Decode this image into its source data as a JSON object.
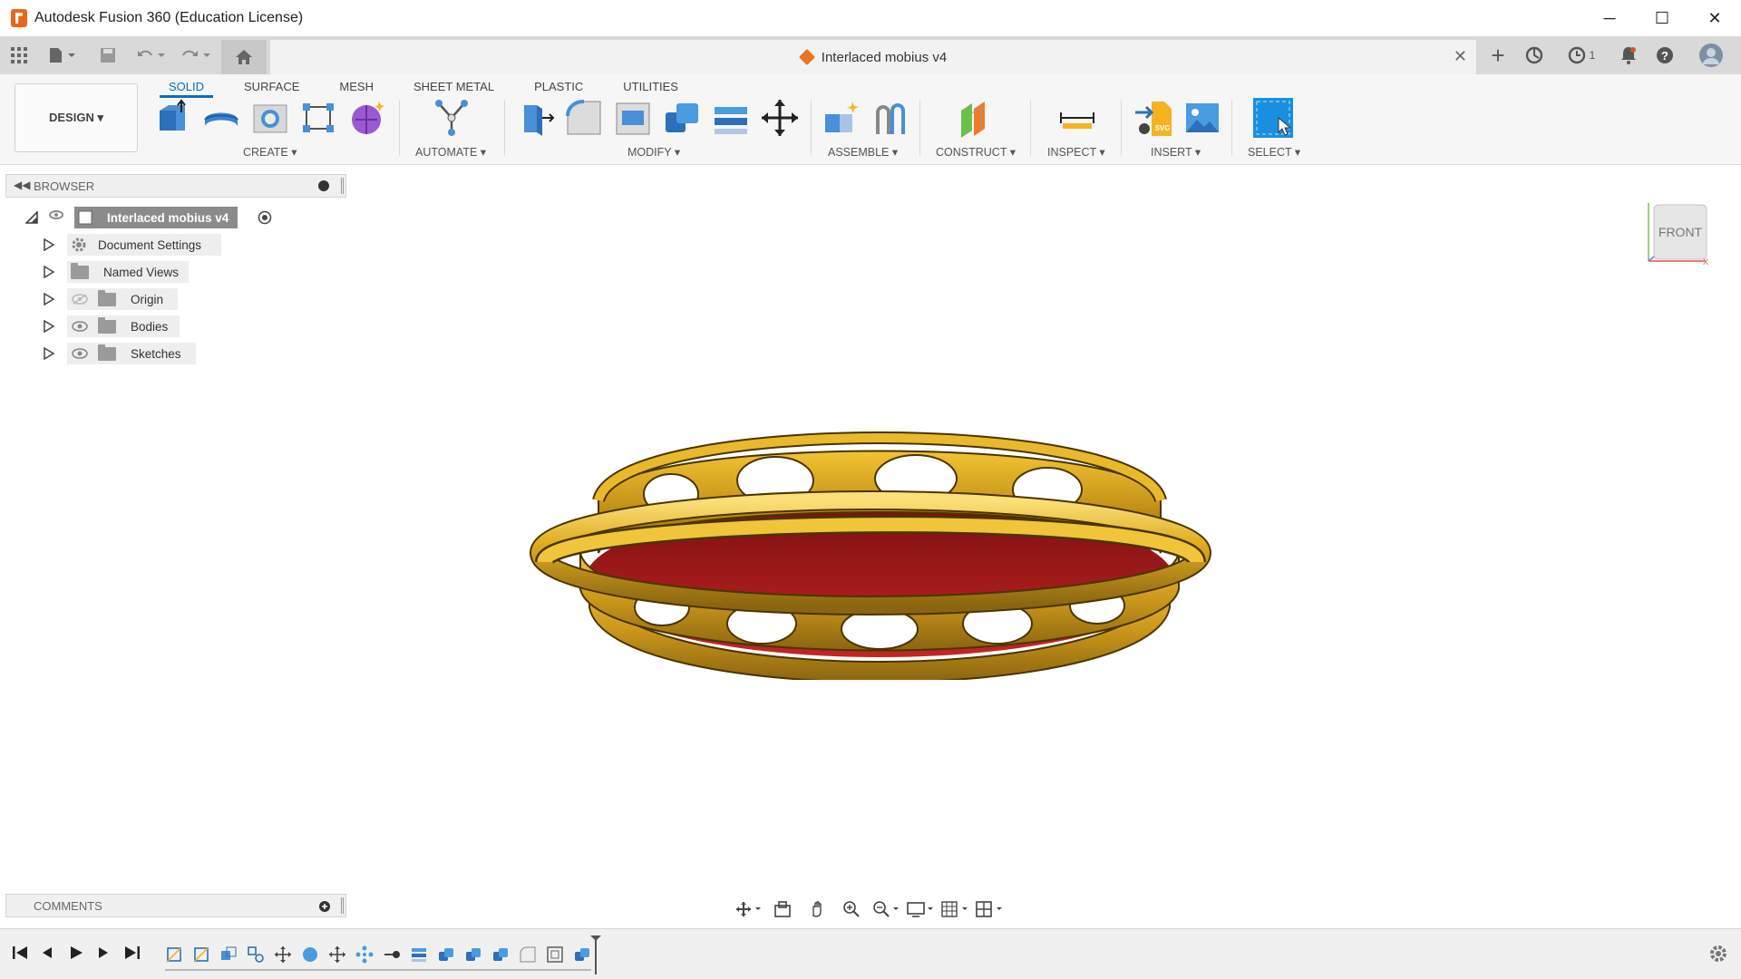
{
  "window": {
    "title": "Autodesk Fusion 360 (Education License)",
    "minimize": "─",
    "maximize": "☐",
    "close": "✕"
  },
  "tabs": {
    "document_title": "Interlaced mobius v4",
    "close": "✕",
    "new_tab": "+",
    "job_count": "1"
  },
  "workspace": {
    "design_label": "DESIGN ▾",
    "tabs": [
      "SOLID",
      "SURFACE",
      "MESH",
      "SHEET METAL",
      "PLASTIC",
      "UTILITIES"
    ],
    "active_tab": "SOLID"
  },
  "toolbar_groups": {
    "create": "CREATE ▾",
    "automate": "AUTOMATE ▾",
    "modify": "MODIFY ▾",
    "assemble": "ASSEMBLE ▾",
    "construct": "CONSTRUCT ▾",
    "inspect": "INSPECT ▾",
    "insert": "INSERT ▾",
    "select": "SELECT ▾"
  },
  "browser": {
    "title": "BROWSER",
    "root": "Interlaced mobius v4",
    "items": [
      {
        "label": "Document Settings",
        "icon": "gear-icon"
      },
      {
        "label": "Named Views",
        "icon": "folder-icon"
      },
      {
        "label": "Origin",
        "icon": "folder-icon",
        "hidden": true
      },
      {
        "label": "Bodies",
        "icon": "folder-icon"
      },
      {
        "label": "Sketches",
        "icon": "folder-icon"
      }
    ]
  },
  "comments": {
    "title": "COMMENTS"
  },
  "viewcube": {
    "face": "FRONT"
  },
  "colors": {
    "accent": "#0a6ebd",
    "model_gold": "#d9a51b",
    "model_red": "#b01c1c",
    "brand_orange": "#e8671a"
  }
}
